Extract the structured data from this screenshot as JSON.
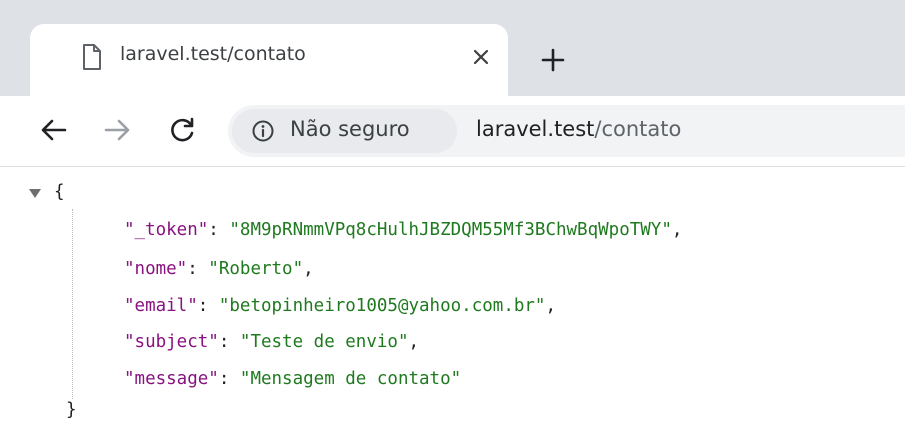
{
  "browser": {
    "tab": {
      "title": "laravel.test/contato",
      "icon": "page-icon"
    },
    "new_tab": "+",
    "security_label": "Não seguro",
    "url": {
      "host": "laravel.test",
      "path": "/contato"
    }
  },
  "json": {
    "open_brace": "{",
    "close_brace": "}",
    "entries": [
      {
        "key": "\"_token\"",
        "value": "\"8M9pRNmmVPq8cHulhJBZDQM55Mf3BChwBqWpoTWY\"",
        "sep": ","
      },
      {
        "key": "\"nome\"",
        "value": "\"Roberto\"",
        "sep": ","
      },
      {
        "key": "\"email\"",
        "value": "\"betopinheiro1005@yahoo.com.br\"",
        "sep": ","
      },
      {
        "key": "\"subject\"",
        "value": "\"Teste de envio\"",
        "sep": ","
      },
      {
        "key": "\"message\"",
        "value": "\"Mensagem de contato\"",
        "sep": ""
      }
    ]
  },
  "colors": {
    "key": "#202124",
    "string_value": "#1f7a1f",
    "tabstrip": "#dee1e6"
  }
}
